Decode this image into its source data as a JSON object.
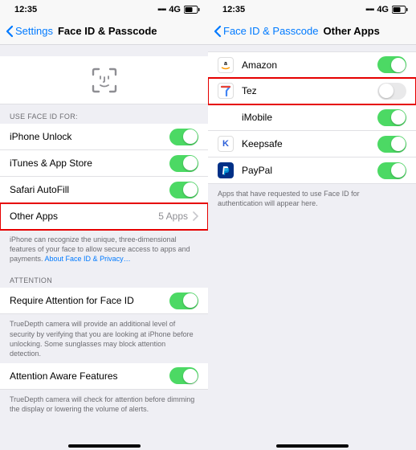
{
  "status": {
    "time": "12:35",
    "network": "4G"
  },
  "left": {
    "back": "Settings",
    "title": "Face ID & Passcode",
    "useFaceIdHeader": "USE FACE ID FOR:",
    "rows": {
      "iphoneUnlock": "iPhone Unlock",
      "itunes": "iTunes & App Store",
      "safari": "Safari AutoFill",
      "otherApps": "Other Apps",
      "otherAppsCount": "5 Apps"
    },
    "footer1a": "iPhone can recognize the unique, three-dimensional features of your face to allow secure access to apps and payments. ",
    "footer1link": "About Face ID & Privacy…",
    "attentionHeader": "ATTENTION",
    "requireAttention": "Require Attention for Face ID",
    "footer2": "TrueDepth camera will provide an additional level of security by verifying that you are looking at iPhone before unlocking. Some sunglasses may block attention detection.",
    "attentionAware": "Attention Aware Features",
    "footer3": "TrueDepth camera will check for attention before dimming the display or lowering the volume of alerts."
  },
  "right": {
    "back": "Face ID & Passcode",
    "title": "Other Apps",
    "apps": {
      "amazon": "Amazon",
      "tez": "Tez",
      "imobile": "iMobile",
      "keepsafe": "Keepsafe",
      "paypal": "PayPal"
    },
    "footer": "Apps that have requested to use Face ID for authentication will appear here."
  },
  "colors": {
    "amazon": "#ffffff",
    "tez": "#ffffff",
    "imobile": "#c8102e",
    "keepsafe": "#ffffff",
    "paypal": "#003087"
  }
}
